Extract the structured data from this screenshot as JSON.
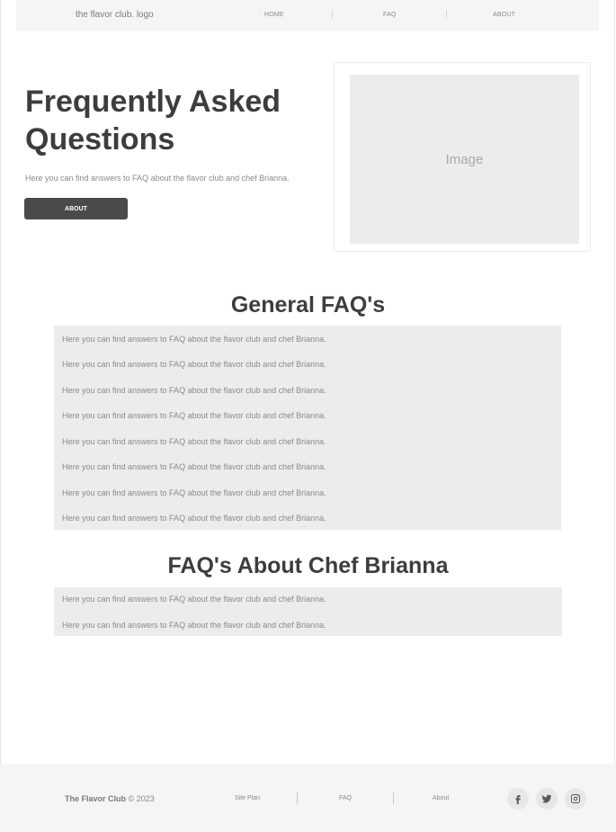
{
  "header": {
    "logo": "the flavor club. logo",
    "nav": [
      "HOME",
      "FAQ",
      "ABOUT"
    ]
  },
  "hero": {
    "title": "Frequently Asked Questions",
    "subtitle": "Here you can find answers to FAQ about the flavor club and chef Brianna.",
    "button": "ABOUT",
    "image_placeholder": "Image"
  },
  "general": {
    "title": "General FAQ's",
    "items": [
      "Here you can find answers to FAQ about the flavor club and chef Brianna.",
      "Here you can find answers to FAQ about the flavor club and chef Brianna.",
      "Here you can find answers to FAQ about the flavor club and chef Brianna.",
      "Here you can find answers to FAQ about the flavor club and chef Brianna.",
      "Here you can find answers to FAQ about the flavor club and chef Brianna.",
      "Here you can find answers to FAQ about the flavor club and chef Brianna.",
      "Here you can find answers to FAQ about the flavor club and chef Brianna.",
      "Here you can find answers to FAQ about the flavor club and chef Brianna."
    ]
  },
  "chef": {
    "title": "FAQ's About Chef Brianna",
    "items": [
      "Here you can find answers to FAQ about the flavor club and chef Brianna.",
      "Here you can find answers to FAQ about the flavor club and chef Brianna."
    ]
  },
  "footer": {
    "brand": "The Flavor Club",
    "copyright": "© 2023",
    "links": [
      "Site Plan",
      "FAQ",
      "About"
    ],
    "social_icons": [
      "facebook-icon",
      "twitter-icon",
      "instagram-icon"
    ]
  },
  "colors": {
    "text_dark": "#3d3d3d",
    "text_muted": "#8a8a8a",
    "button": "#4a4a4a",
    "panel": "#ececec",
    "header_bg": "#f6f4f4"
  }
}
